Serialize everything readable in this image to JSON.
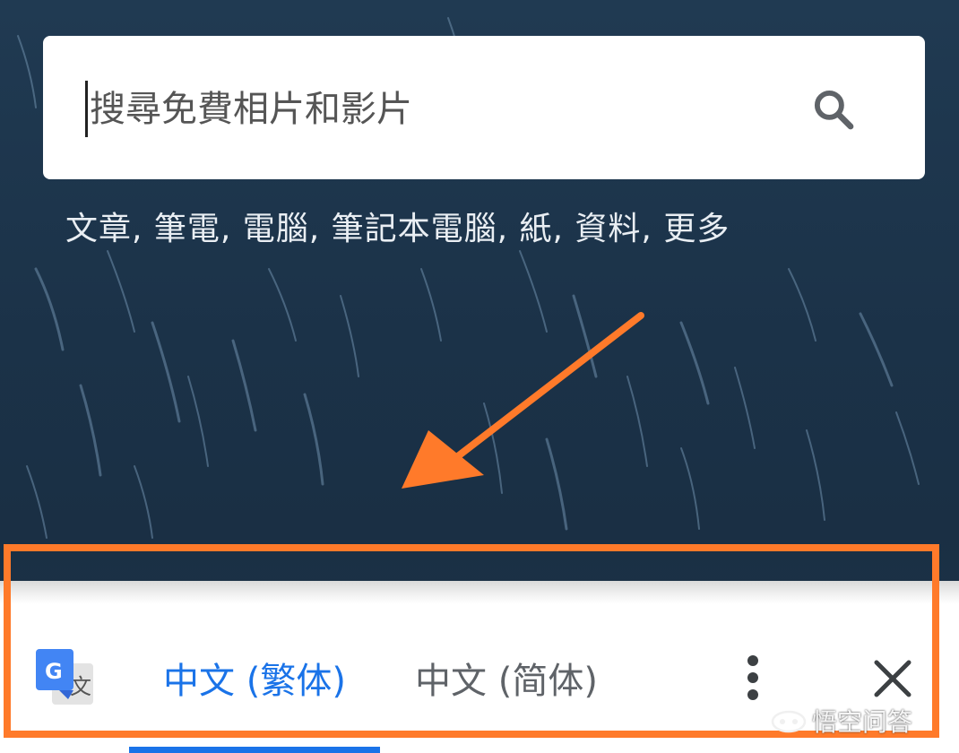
{
  "search": {
    "placeholder": "搜尋免費相片和影片"
  },
  "suggestions": {
    "text": "文章, 筆電, 電腦, 筆記本電腦, 紙, 資料, 更多"
  },
  "translate_bar": {
    "logo_letter": "G",
    "logo_char": "文",
    "tabs": [
      {
        "label": "中文 (繁体)",
        "active": true
      },
      {
        "label": "中文 (简体)",
        "active": false
      }
    ]
  },
  "watermark": {
    "text": "悟空问答"
  },
  "colors": {
    "accent": "#1a73e8",
    "annotation": "#ff7a2a",
    "background": "#1d3347"
  }
}
